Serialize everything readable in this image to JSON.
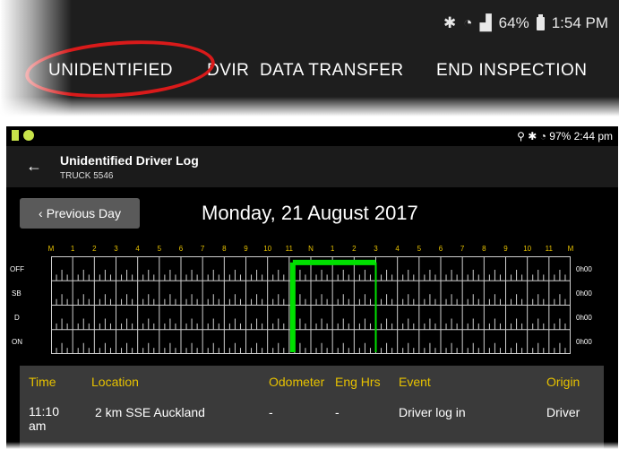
{
  "top_screenshot": {
    "status": {
      "icons": [
        "bluetooth-icon",
        "wifi-icon",
        "signal-icon",
        "battery-icon"
      ],
      "battery": "64%",
      "time": "1:54 PM"
    },
    "tabs": [
      "UNIDENTIFIED",
      "DVIR",
      "DATA TRANSFER",
      "END INSPECTION"
    ],
    "highlight_color": "#d91a1a"
  },
  "bottom_screenshot": {
    "status": {
      "text": "97% 2:44 pm"
    },
    "app_bar": {
      "title": "Unidentified Driver Log",
      "subtitle": "TRUCK 5546"
    },
    "previous_day_label": "Previous Day",
    "date": "Monday, 21 August 2017",
    "hour_labels": [
      "M",
      "1",
      "2",
      "3",
      "4",
      "5",
      "6",
      "7",
      "8",
      "9",
      "10",
      "11",
      "N",
      "1",
      "2",
      "3",
      "4",
      "5",
      "6",
      "7",
      "8",
      "9",
      "10",
      "11",
      "M"
    ],
    "duty_rows": [
      {
        "label": "OFF",
        "total": "0h00"
      },
      {
        "label": "SB",
        "total": "0h00"
      },
      {
        "label": "D",
        "total": "0h00"
      },
      {
        "label": "ON",
        "total": "0h00"
      }
    ],
    "graph_color": "#00e000",
    "table": {
      "headers": [
        "Time",
        "Location",
        "Odometer",
        "Eng Hrs",
        "Event",
        "Origin"
      ],
      "rows": [
        [
          "11:10 am",
          "2 km SSE Auckland",
          "-",
          "-",
          "Driver log in",
          "Driver"
        ]
      ]
    }
  }
}
